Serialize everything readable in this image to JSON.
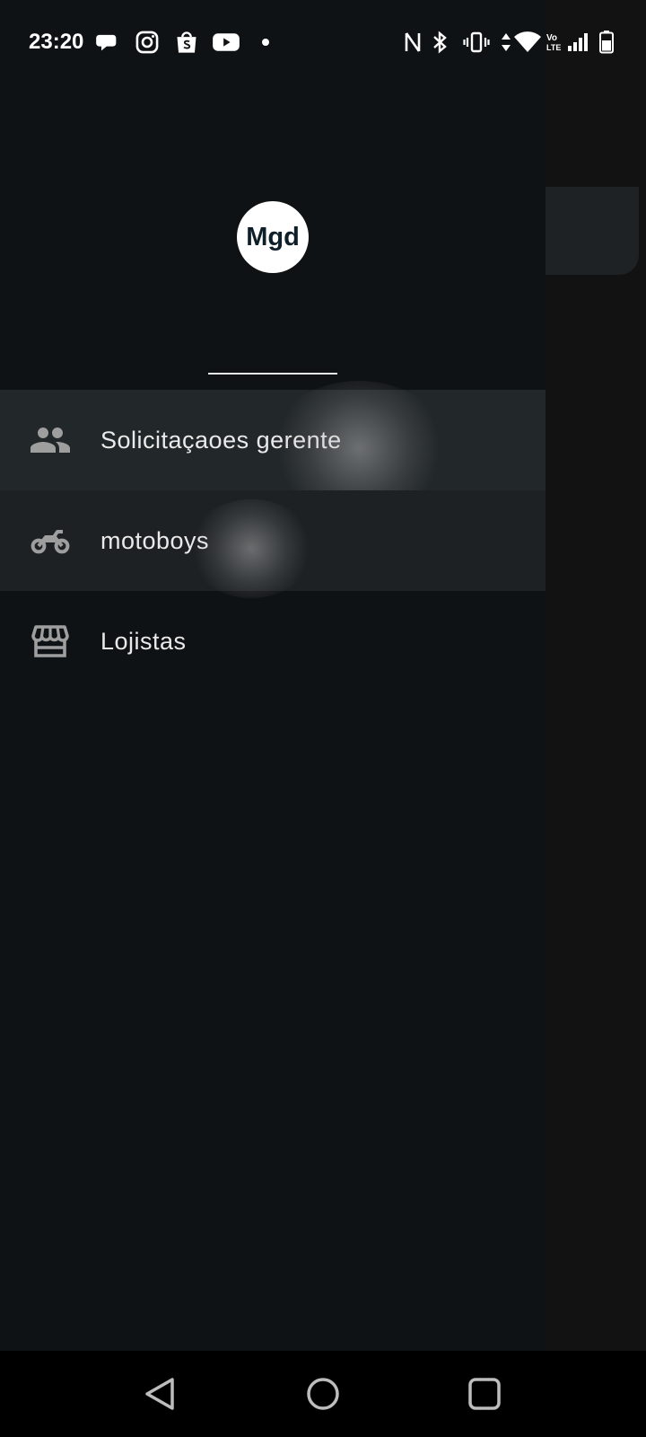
{
  "status_bar": {
    "time": "23:20",
    "left_icons": [
      "chat-bubble-icon",
      "instagram-icon",
      "shopee-bag-icon",
      "youtube-icon",
      "dot-icon"
    ],
    "right_icons": [
      "nfc-icon",
      "bluetooth-icon",
      "vibrate-icon",
      "data-arrows-icon",
      "wifi-icon",
      "volte-icon",
      "signal-icon",
      "battery-icon"
    ]
  },
  "drawer": {
    "avatar_initials": "Mgd",
    "items": [
      {
        "label": "Solicitaçaoes gerente",
        "icon": "people-icon"
      },
      {
        "label": "motoboys",
        "icon": "motorcycle-icon"
      },
      {
        "label": "Lojistas",
        "icon": "storefront-icon"
      }
    ]
  },
  "nav_bar": {
    "buttons": [
      "back-triangle-icon",
      "home-circle-icon",
      "recents-square-icon"
    ]
  },
  "colors": {
    "drawer_bg": "#0f1214",
    "selected_bg": "#22272a",
    "icon_gray": "#9e9e9e",
    "avatar_bg": "#ffffff"
  }
}
